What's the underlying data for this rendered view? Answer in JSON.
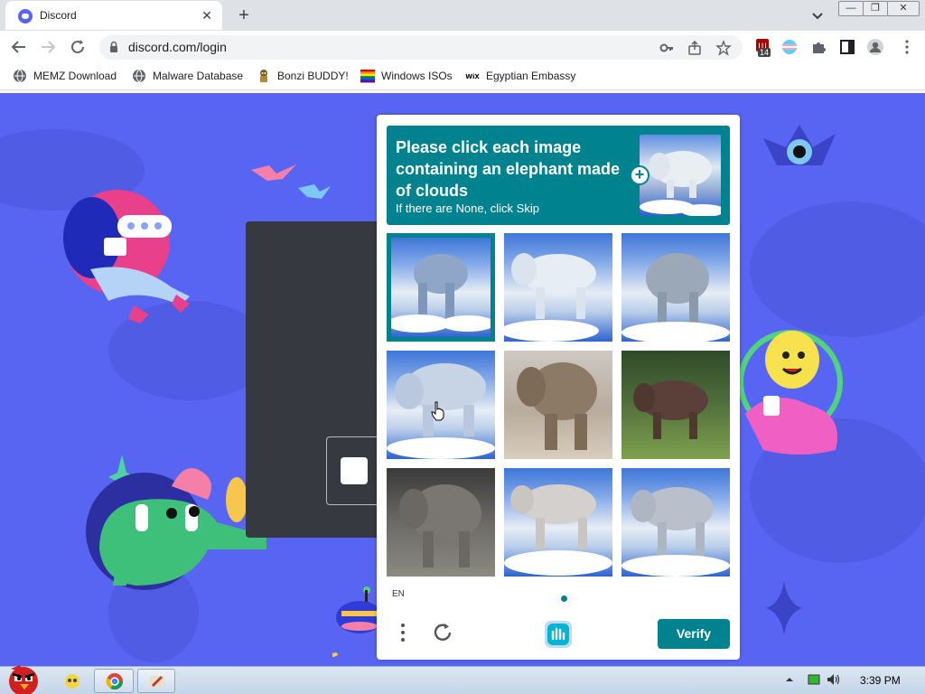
{
  "browser": {
    "tab_title": "Discord",
    "tab_close": "✕",
    "new_tab": "+",
    "url": "discord.com/login",
    "window_controls": [
      "—",
      "❐",
      "✕"
    ],
    "extension_badge": "14"
  },
  "bookmarks": [
    {
      "label": "MEMZ Download",
      "icon": "globe-icon"
    },
    {
      "label": "Malware Database",
      "icon": "globe-icon"
    },
    {
      "label": "Bonzi BUDDY!",
      "icon": "bonzi-icon"
    },
    {
      "label": "Windows ISOs",
      "icon": "rainbow-flag-icon"
    },
    {
      "label": "Egyptian Embassy",
      "icon": "wix-icon"
    }
  ],
  "captcha": {
    "prompt": "Please click each image containing an elephant made of clouds",
    "subtext": "If there are None, click Skip",
    "language": "EN",
    "verify_label": "Verify",
    "tiles": [
      {
        "kind": "cloud",
        "selected": true
      },
      {
        "kind": "cloud",
        "selected": false
      },
      {
        "kind": "cloud",
        "selected": false
      },
      {
        "kind": "cloud",
        "selected": false
      },
      {
        "kind": "real",
        "selected": false
      },
      {
        "kind": "real",
        "selected": false
      },
      {
        "kind": "real",
        "selected": false
      },
      {
        "kind": "cloud",
        "selected": false
      },
      {
        "kind": "cloud",
        "selected": false
      }
    ],
    "accent_color": "#00838f"
  },
  "page": {
    "background_color": "#5865f2"
  },
  "taskbar": {
    "clock": "3:39 PM"
  }
}
